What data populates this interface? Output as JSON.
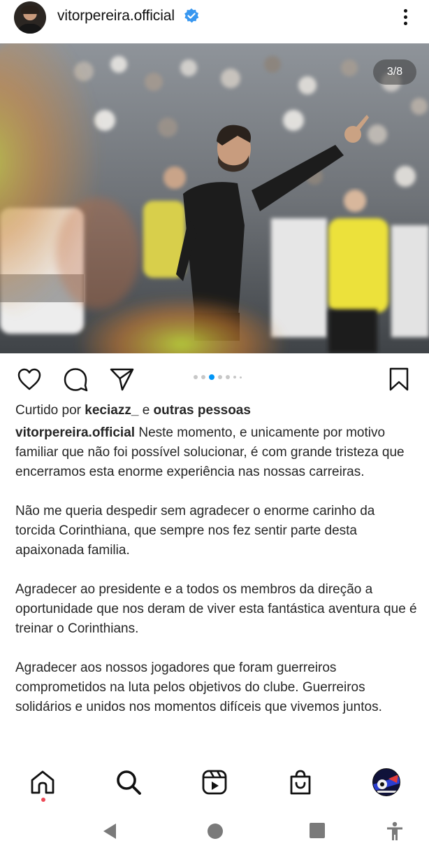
{
  "header": {
    "username": "vitorpereira.official",
    "verified": true,
    "avatar_icon": "profile-avatar",
    "more_icon": "more-vertical-icon"
  },
  "post": {
    "image_counter": "3/8",
    "carousel": {
      "total_dots": 6,
      "active_index": 2
    }
  },
  "actions": {
    "like_icon": "heart-icon",
    "comment_icon": "comment-icon",
    "share_icon": "send-icon",
    "save_icon": "bookmark-icon"
  },
  "likes": {
    "prefix": "Curtido por",
    "user": "keciazz_",
    "conjunction": "e",
    "others": "outras pessoas"
  },
  "caption": {
    "username": "vitorpereira.official",
    "paragraphs": [
      "Neste momento, e unicamente por motivo familiar que não foi possível solucionar, é com grande tristeza que encerramos esta enorme experiência nas nossas carreiras.",
      "Não me queria despedir sem agradecer o enorme carinho da torcida Corinthiana, que sempre nos fez sentir parte desta apaixonada familia.",
      "Agradecer ao presidente e a todos os membros da direção a oportunidade que nos deram de viver esta fantástica aventura que é treinar o Corinthians.",
      "Agradecer aos nossos jogadores que foram guerreiros comprometidos na luta pelos objetivos do clube. Guerreiros solidários e unidos nos momentos difíceis que vivemos juntos."
    ]
  },
  "bottom_nav": {
    "items": [
      "home-icon",
      "search-icon",
      "reels-icon",
      "shop-icon",
      "profile-avatar"
    ],
    "active": "home-icon",
    "notification_color": "#ed4956"
  },
  "system_nav": {
    "items": [
      "back-icon",
      "home-circle-icon",
      "recents-icon",
      "accessibility-icon"
    ]
  },
  "colors": {
    "verified_blue": "#3897f0",
    "carousel_active": "#0095f6",
    "text": "#262626"
  }
}
